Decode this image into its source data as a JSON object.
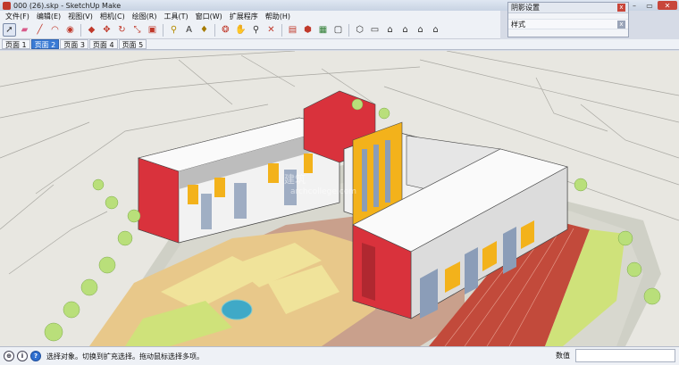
{
  "window": {
    "title": "000 (26).skp - SketchUp Make",
    "minimize": "–",
    "restore": "▭",
    "close": "✕"
  },
  "menu": [
    "文件(F)",
    "编辑(E)",
    "视图(V)",
    "相机(C)",
    "绘图(R)",
    "工具(T)",
    "窗口(W)",
    "扩展程序",
    "帮助(H)"
  ],
  "toolbar_icons": [
    "select-icon",
    "eraser-icon",
    "pencil-icon",
    "arc-icon",
    "shape-icon",
    "push-pull-icon",
    "move-icon",
    "rotate-icon",
    "scale-icon",
    "offset-icon",
    "tape-measure-icon",
    "text-icon",
    "paint-bucket-icon",
    "orbit-icon",
    "pan-icon",
    "zoom-icon",
    "zoom-extents-icon",
    "warehouse-icon",
    "extension-warehouse-icon",
    "layout-icon",
    "style-icon",
    "iso-view-icon",
    "top-view-icon",
    "front-view-icon",
    "right-view-icon",
    "back-view-icon",
    "left-view-icon"
  ],
  "scenes": {
    "tabs": [
      "页面 1",
      "页面 2",
      "页面 3",
      "页面 4",
      "页面 5"
    ],
    "active_index": 1
  },
  "tray": {
    "title": "阴影设置",
    "section": "样式",
    "close_glyph": "x"
  },
  "status": {
    "hint": "选择对象。切换到扩充选择。拖动鼠标选择多项。",
    "measure_label": "数值",
    "measure_value": ""
  },
  "watermark": {
    "line1": "建筑",
    "line2": "archcollege.com"
  },
  "colors": {
    "accent_tab": "#3a7bd5",
    "facade_red": "#d9323c",
    "facade_yellow": "#f3b21b",
    "plaza": "#c9a08c",
    "lawn": "#cfe27a",
    "running_track": "#c24a3b",
    "pool": "#3fa9c7"
  }
}
